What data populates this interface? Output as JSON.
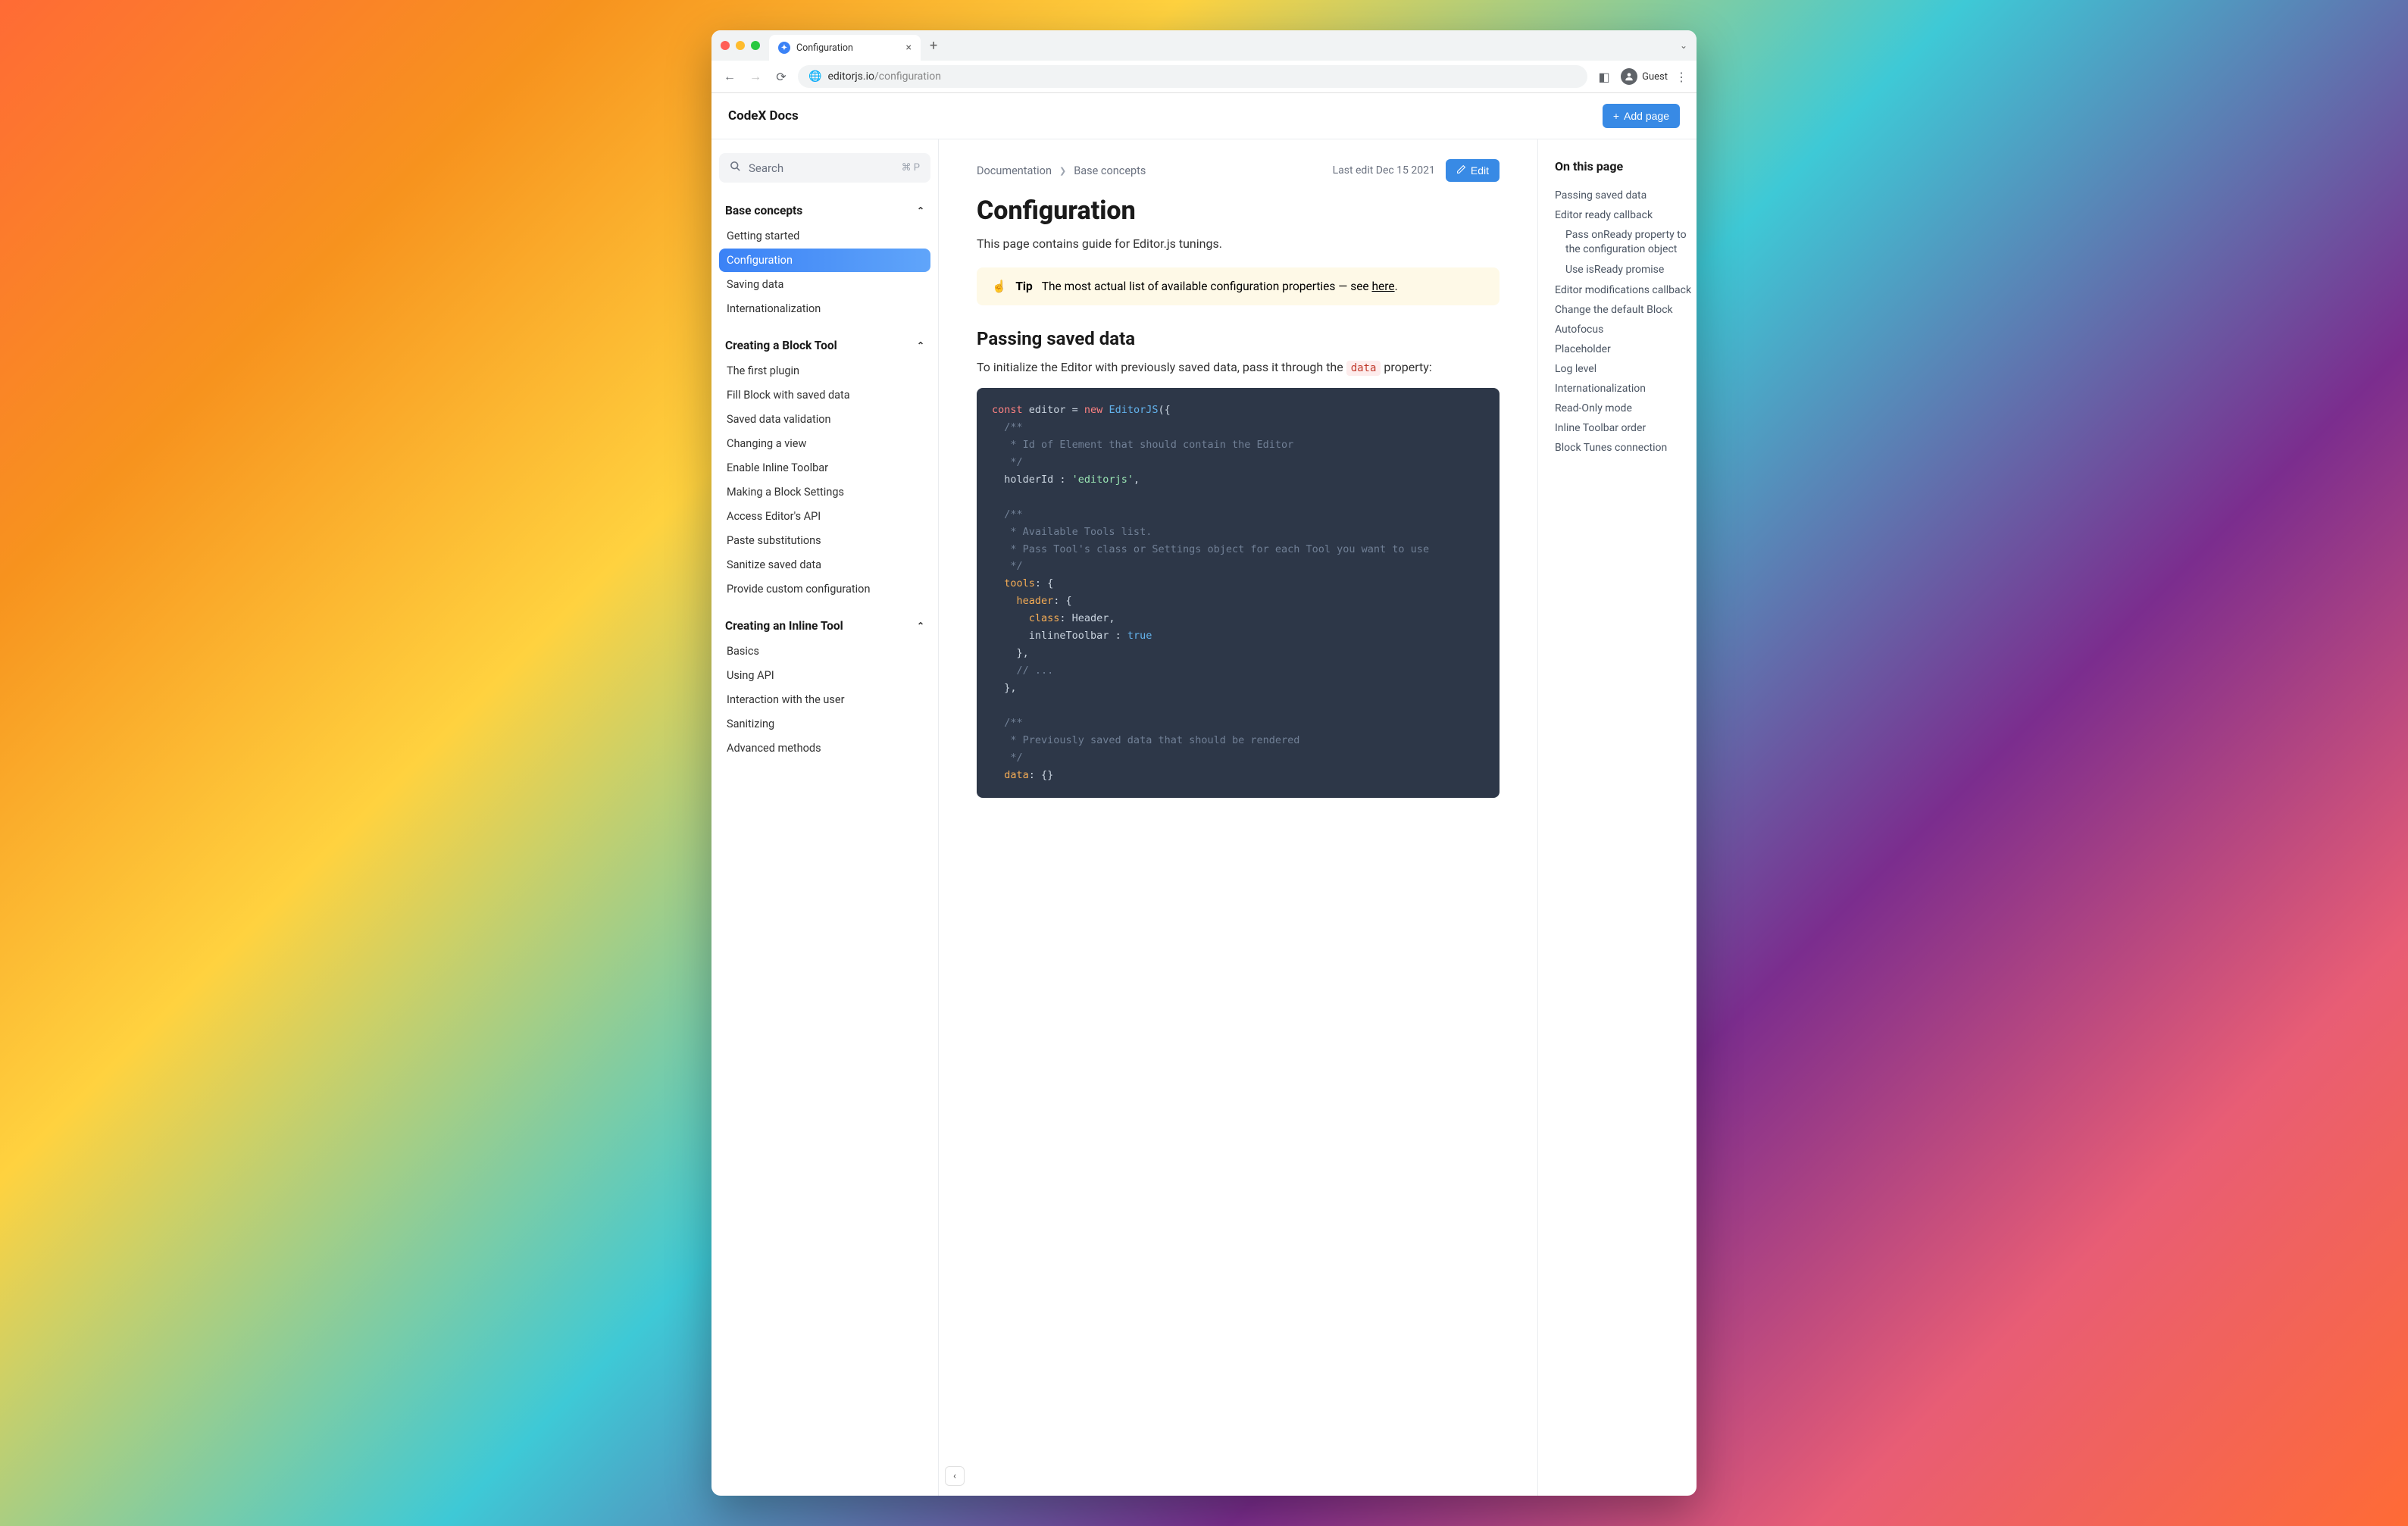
{
  "browser": {
    "tab_title": "Configuration",
    "url_domain": "editorjs.io",
    "url_path": "/configuration",
    "guest_label": "Guest"
  },
  "header": {
    "app_title": "CodeX Docs",
    "add_page": "Add page"
  },
  "search": {
    "placeholder": "Search",
    "shortcut": "⌘ P"
  },
  "sidebar": {
    "sections": [
      {
        "title": "Base concepts",
        "items": [
          "Getting started",
          "Configuration",
          "Saving data",
          "Internationalization"
        ],
        "active_index": 1
      },
      {
        "title": "Creating a Block Tool",
        "items": [
          "The first plugin",
          "Fill Block with saved data",
          "Saved data validation",
          "Changing a view",
          "Enable Inline Toolbar",
          "Making a Block Settings",
          "Access Editor's API",
          "Paste substitutions",
          "Sanitize saved data",
          "Provide custom configuration"
        ]
      },
      {
        "title": "Creating an Inline Tool",
        "items": [
          "Basics",
          "Using API",
          "Interaction with the user",
          "Sanitizing",
          "Advanced methods"
        ]
      }
    ]
  },
  "breadcrumb": [
    "Documentation",
    "Base concepts"
  ],
  "last_edit": "Last edit Dec 15 2021",
  "edit_label": "Edit",
  "page_title": "Configuration",
  "intro": "This page contains guide for Editor.js tunings.",
  "tip": {
    "emoji": "☝️",
    "label": "Tip",
    "text": "The most actual list of available configuration properties — see ",
    "link": "here"
  },
  "section_heading": "Passing saved data",
  "body_before": "To initialize the Editor with previously saved data, pass it through the ",
  "body_code": "data",
  "body_after": " property:",
  "code": {
    "l1_const": "const",
    "l1_rest": " editor = ",
    "l1_new": "new",
    "l1_class": " EditorJS",
    "l1_open": "({",
    "c1_a": "  /**",
    "c1_b": "   * Id of Element that should contain the Editor",
    "c1_c": "   */",
    "l2_key": "  holderId ",
    "l2_colon": ": ",
    "l2_val": "'editorjs'",
    "l2_comma": ",",
    "c2_a": "  /**",
    "c2_b": "   * Available Tools list.",
    "c2_c": "   * Pass Tool's class or Settings object for each Tool you want to use",
    "c2_d": "   */",
    "l3": "  tools",
    "l3_b": ": {",
    "l4": "    header",
    "l4_b": ": {",
    "l5": "      class",
    "l5_b": ": Header,",
    "l6": "      inlineToolbar ",
    "l6_b": ": ",
    "l6_c": "true",
    "l7": "    },",
    "l8": "    // ...",
    "l9": "  },",
    "c3_a": "  /**",
    "c3_b": "   * Previously saved data that should be rendered",
    "c3_c": "   */",
    "l10": "  data",
    "l10_b": ": {}"
  },
  "toc": {
    "title": "On this page",
    "items": [
      {
        "label": "Passing saved data"
      },
      {
        "label": "Editor ready callback"
      },
      {
        "label": "Pass onReady property to the configuration object",
        "indent": true
      },
      {
        "label": "Use isReady promise",
        "indent": true
      },
      {
        "label": "Editor modifications callback"
      },
      {
        "label": "Change the default Block"
      },
      {
        "label": "Autofocus"
      },
      {
        "label": "Placeholder"
      },
      {
        "label": "Log level"
      },
      {
        "label": "Internationalization"
      },
      {
        "label": "Read-Only mode"
      },
      {
        "label": "Inline Toolbar order"
      },
      {
        "label": "Block Tunes connection"
      }
    ]
  }
}
